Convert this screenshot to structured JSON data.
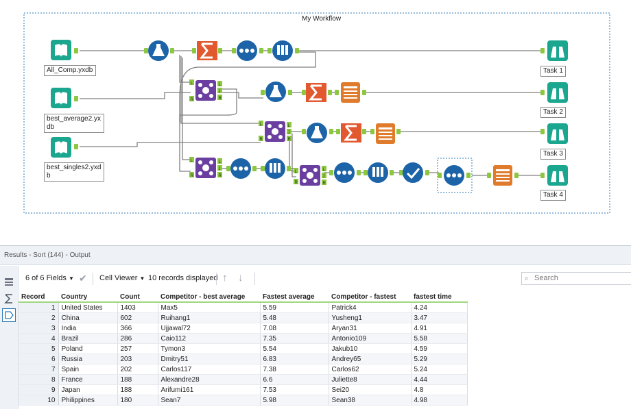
{
  "workflow": {
    "title": "My Workflow",
    "inputs": [
      "All_Comp.yxdb",
      "best_average2.yx\ndb",
      "best_singles2.yxd\nb"
    ],
    "outputs": [
      "Task 1",
      "Task 2",
      "Task 3",
      "Task 4"
    ],
    "join_anchors": {
      "left": "L",
      "right": "R",
      "join": "J"
    }
  },
  "results": {
    "title": "Results - Sort (144) - Output",
    "fields_label": "6 of 6 Fields",
    "viewer_label": "Cell Viewer",
    "records_label": "10 records displayed",
    "search_placeholder": "Search",
    "columns": [
      "Record",
      "Country",
      "Count",
      "Competitor - best average",
      "Fastest average",
      "Competitor - fastest",
      "fastest time"
    ],
    "rows": [
      [
        "1",
        "United States",
        "1403",
        "Max5",
        "5.59",
        "Patrick4",
        "4.24"
      ],
      [
        "2",
        "China",
        "602",
        "Ruihang1",
        "5.48",
        "Yusheng1",
        "3.47"
      ],
      [
        "3",
        "India",
        "366",
        "Ujjawal72",
        "7.08",
        "Aryan31",
        "4.91"
      ],
      [
        "4",
        "Brazil",
        "286",
        "Caio112",
        "7.35",
        "Antonio109",
        "5.58"
      ],
      [
        "5",
        "Poland",
        "257",
        "Tymon3",
        "5.54",
        "Jakub10",
        "4.59"
      ],
      [
        "6",
        "Russia",
        "203",
        "Dmitry51",
        "6.83",
        "Andrey65",
        "5.29"
      ],
      [
        "7",
        "Spain",
        "202",
        "Carlos117",
        "7.38",
        "Carlos62",
        "5.24"
      ],
      [
        "8",
        "France",
        "188",
        "Alexandre28",
        "6.6",
        "Juliette8",
        "4.44"
      ],
      [
        "9",
        "Japan",
        "188",
        "Arifumi161",
        "7.53",
        "Sei20",
        "4.8"
      ],
      [
        "10",
        "Philippines",
        "180",
        "Sean7",
        "5.98",
        "Sean38",
        "4.98"
      ]
    ]
  },
  "colors": {
    "input_tool": "#1ba68f",
    "transform_tool": "#1c63a8",
    "summarize_tool": "#e2582f",
    "output_tool": "#1ba68f",
    "browse_tool": "#e07b2c",
    "join_tool": "#6b3fa0",
    "anchor": "#8dc63f"
  }
}
